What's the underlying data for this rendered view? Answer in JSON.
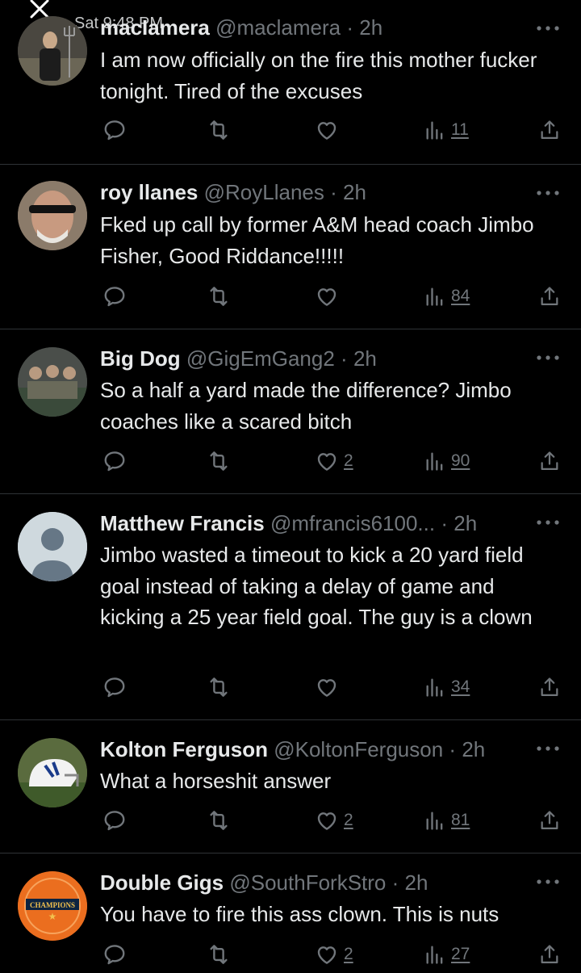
{
  "status": {
    "time": "Sat 9:48 PM"
  },
  "tweets": [
    {
      "name": "macIamera",
      "handle": "@maclamera",
      "time": "2h",
      "text": "I am now officially on the fire this mother fucker tonight. Tired of the excuses",
      "likes": "",
      "views": "11"
    },
    {
      "name": "roy llanes",
      "handle": "@RoyLlanes",
      "time": "2h",
      "text": "Fked up call by former A&M head coach Jimbo Fisher, Good Riddance!!!!!",
      "likes": "",
      "views": "84"
    },
    {
      "name": "Big Dog",
      "handle": "@GigEmGang2",
      "time": "2h",
      "text": "So a half a yard made the difference? Jimbo coaches like a scared bitch",
      "likes": "2",
      "views": "90"
    },
    {
      "name": "Matthew Francis",
      "handle": "@mfrancis6100...",
      "time": "2h",
      "text": "Jimbo wasted a timeout to kick a 20 yard field goal instead of taking a delay of game and kicking a 25 year field goal.  The guy is a clown",
      "likes": "",
      "views": "34"
    },
    {
      "name": "Kolton Ferguson",
      "handle": "@KoltonFerguson",
      "time": "2h",
      "text": "What a horseshit answer",
      "likes": "2",
      "views": "81"
    },
    {
      "name": "Double Gigs",
      "handle": "@SouthForkStro",
      "time": "2h",
      "text": "You have to fire this ass clown. This is nuts",
      "likes": "2",
      "views": "27",
      "avatar_badge": "CHAMPIONS"
    }
  ],
  "icons": [
    "close-icon",
    "more-icon",
    "reply-icon",
    "retweet-icon",
    "like-icon",
    "views-icon",
    "share-icon"
  ]
}
